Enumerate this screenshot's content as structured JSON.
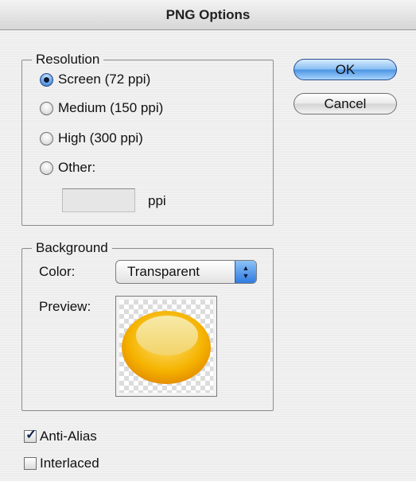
{
  "dialog": {
    "title": "PNG Options"
  },
  "resolution": {
    "legend": "Resolution",
    "options": [
      {
        "label": "Screen (72 ppi)",
        "selected": true
      },
      {
        "label": "Medium (150 ppi)",
        "selected": false
      },
      {
        "label": "High (300 ppi)",
        "selected": false
      },
      {
        "label": "Other:",
        "selected": false
      }
    ],
    "other_value": "",
    "unit": "ppi"
  },
  "buttons": {
    "ok": "OK",
    "cancel": "Cancel"
  },
  "background": {
    "legend": "Background",
    "color_label": "Color:",
    "color_value": "Transparent",
    "preview_label": "Preview:"
  },
  "options": {
    "anti_alias": {
      "label": "Anti-Alias",
      "checked": true
    },
    "interlaced": {
      "label": "Interlaced",
      "checked": false
    }
  },
  "colors": {
    "accent_blue": "#4c95e4",
    "preview_orange": "#f0a000",
    "preview_highlight": "#f7e69a"
  },
  "icons": {
    "stepper": "stepper-arrows-icon",
    "check": "checkmark-icon",
    "radio_dot": "radio-dot-icon"
  }
}
